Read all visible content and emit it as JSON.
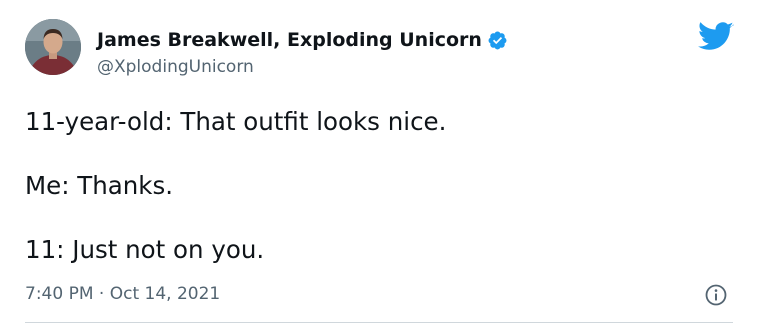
{
  "author": {
    "display_name": "James Breakwell, Exploding Unicorn",
    "handle": "@XplodingUnicorn",
    "verified": true,
    "avatar_icon": "avatar"
  },
  "tweet": {
    "lines": [
      "11-year-old: That outfit looks nice.",
      "Me: Thanks.",
      "11: Just not on you."
    ],
    "time": "7:40 PM",
    "separator": "·",
    "date": "Oct 14, 2021"
  },
  "icons": {
    "brand": "twitter-bird-icon",
    "verified": "verified-badge-icon",
    "info": "info-icon"
  },
  "colors": {
    "brand": "#1d9bf0",
    "text_primary": "#0f1419",
    "text_secondary": "#536471"
  }
}
